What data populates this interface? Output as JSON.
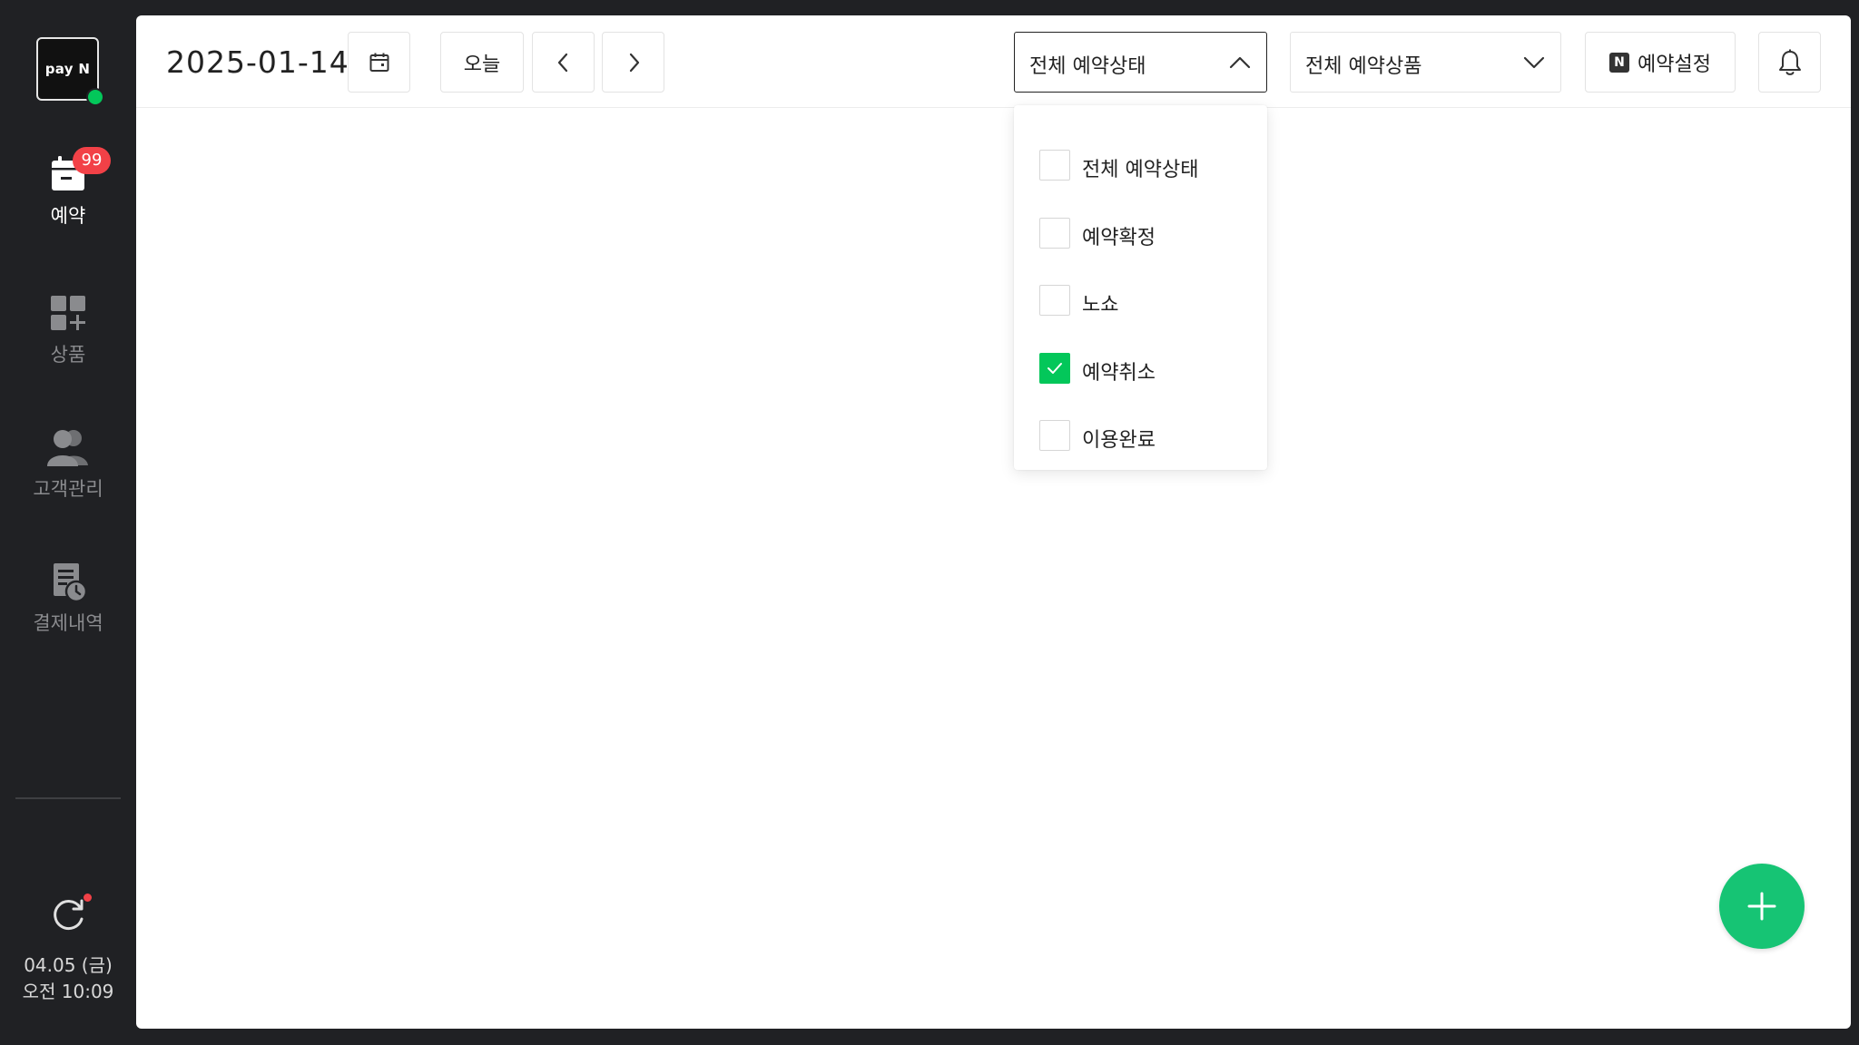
{
  "sidebar": {
    "logo_text": "pay N",
    "nav": [
      {
        "label": "예약",
        "icon": "calendar-icon",
        "active": true
      },
      {
        "label": "상품",
        "icon": "grid-plus-icon",
        "active": false
      },
      {
        "label": "고객관리",
        "icon": "users-icon",
        "active": false
      },
      {
        "label": "결제내역",
        "icon": "receipt-clock-icon",
        "active": false
      }
    ],
    "badge": "99",
    "clock_date": "04.05 (금)",
    "clock_time": "오전 10:09"
  },
  "header": {
    "date": "2025-01-14",
    "today_label": "오늘",
    "status_filter": {
      "selected": "전체 예약상태",
      "open": true
    },
    "product_filter": {
      "selected": "전체 예약상품"
    },
    "settings_label": "예약설정",
    "settings_badge": "N"
  },
  "status_menu": {
    "items": [
      {
        "label": "전체 예약상태",
        "checked": false
      },
      {
        "label": "예약확정",
        "checked": false
      },
      {
        "label": "노쇼",
        "checked": false
      },
      {
        "label": "예약취소",
        "checked": true
      },
      {
        "label": "이용완료",
        "checked": false
      }
    ]
  },
  "colors": {
    "accent": "#03c75a",
    "fab": "#16c474",
    "badge": "#f24147",
    "sidebar_bg": "#202124"
  }
}
